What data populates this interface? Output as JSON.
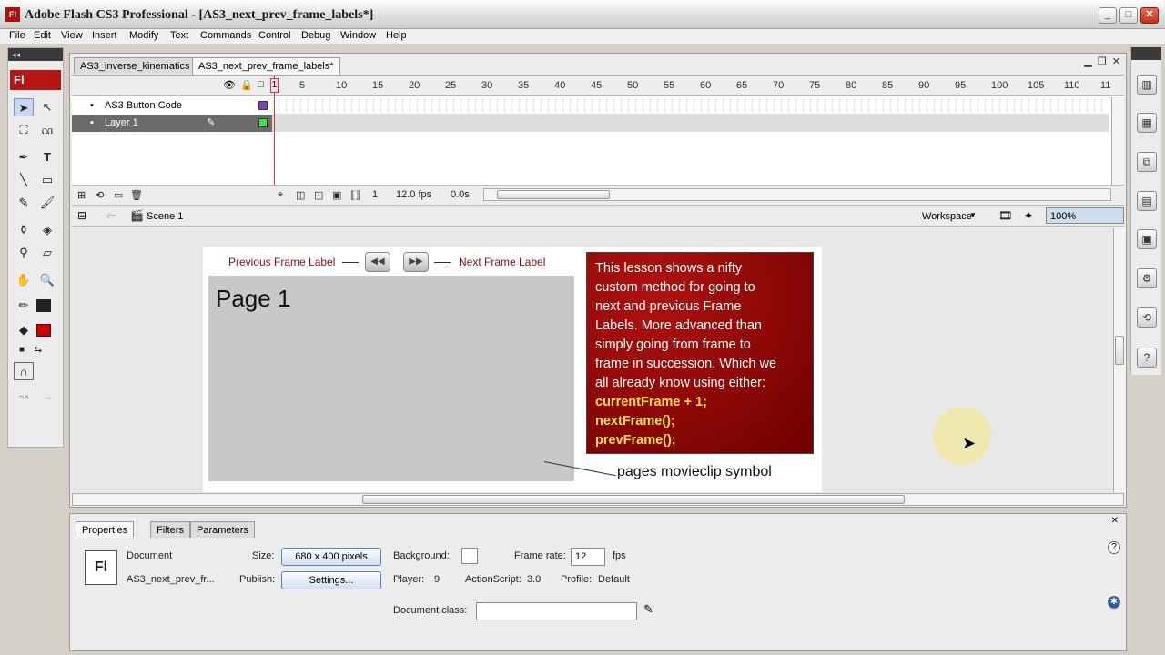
{
  "window": {
    "title": "Adobe Flash CS3 Professional - [AS3_next_prev_frame_labels*]",
    "app_icon": "Fl"
  },
  "menu": [
    "File",
    "Edit",
    "View",
    "Insert",
    "Modify",
    "Text",
    "Commands",
    "Control",
    "Debug",
    "Window",
    "Help"
  ],
  "tools": {
    "brand": "Fl"
  },
  "doc_tabs": [
    "AS3_inverse_kinematics",
    "AS3_next_prev_frame_labels*"
  ],
  "timeline": {
    "frame_numbers": [
      "1",
      "5",
      "10",
      "15",
      "20",
      "25",
      "30",
      "35",
      "40",
      "45",
      "50",
      "55",
      "60",
      "65",
      "70",
      "75",
      "80",
      "85",
      "90",
      "95",
      "100",
      "105",
      "110",
      "11"
    ],
    "layers": [
      {
        "name": "AS3 Button Code",
        "color": "#7a3fbf"
      },
      {
        "name": "Layer 1",
        "color": "#44dd44"
      }
    ],
    "current_frame": "1",
    "fps": "12.0 fps",
    "time": "0.0s"
  },
  "editbar": {
    "scene": "Scene 1",
    "workspace": "Workspace",
    "zoom": "100%"
  },
  "stage": {
    "prev_label": "Previous Frame Label",
    "next_label": "Next Frame Label",
    "page_title": "Page 1",
    "info_lines": [
      "This lesson shows a nifty",
      "custom method for going to",
      "next and previous Frame",
      "Labels. More advanced than",
      "simply going from frame to",
      "frame in succession. Which we",
      "all already know using either:"
    ],
    "code_lines": [
      "currentFrame + 1;",
      "nextFrame();",
      "prevFrame();"
    ],
    "symbol_label": "pages movieclip symbol"
  },
  "properties": {
    "tabs": [
      "Properties",
      "Filters",
      "Parameters"
    ],
    "type": "Document",
    "doc_name": "AS3_next_prev_fr...",
    "size_label": "Size:",
    "size_value": "680 x 400 pixels",
    "publish_label": "Publish:",
    "settings_button": "Settings...",
    "background_label": "Background:",
    "player_label": "Player:",
    "player_value": "9",
    "actionscript_label": "ActionScript:",
    "actionscript_value": "3.0",
    "profile_label": "Profile:",
    "profile_value": "Default",
    "framerate_label": "Frame rate:",
    "framerate_value": "12",
    "fps_unit": "fps",
    "docclass_label": "Document class:",
    "docclass_value": ""
  }
}
